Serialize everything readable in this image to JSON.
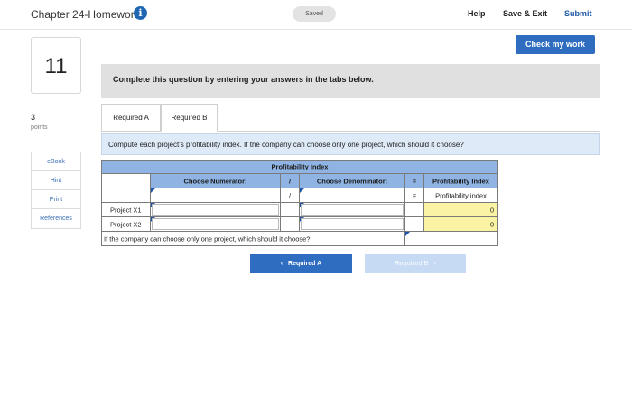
{
  "header": {
    "title": "Chapter 24-Homework",
    "info_icon_glyph": "i",
    "saved_label": "Saved",
    "help_label": "Help",
    "save_exit_label": "Save & Exit",
    "submit_label": "Submit"
  },
  "check_button_label": "Check my work",
  "question": {
    "number": "11",
    "points_value": "3",
    "points_label": "points"
  },
  "sidebar": {
    "items": [
      "eBook",
      "Hint",
      "Print",
      "References"
    ]
  },
  "banner_text": "Complete this question by entering your answers in the tabs below.",
  "tabs": [
    {
      "label": "Required A",
      "active": false
    },
    {
      "label": "Required B",
      "active": true
    }
  ],
  "instructions": "Compute each project's profitability index. If the company can choose only one project, which should it choose?",
  "table": {
    "title": "Profitability Index",
    "numerator_header": "Choose Numerator:",
    "divide_symbol": "/",
    "denominator_header": "Choose Denominator:",
    "equals_symbol": "=",
    "result_header": "Profitability Index",
    "result_subheader": "Profitability index",
    "rows": [
      {
        "label": "Project X1",
        "numerator": "",
        "denominator": "",
        "result": "0"
      },
      {
        "label": "Project X2",
        "numerator": "",
        "denominator": "",
        "result": "0"
      }
    ],
    "choice_question": "If the company can choose only one project, which should it choose?",
    "choice_answer": ""
  },
  "nav": {
    "prev_label": "Required A",
    "next_label": "Required B"
  },
  "colors": {
    "accent_blue": "#2f6dc1",
    "header_blue": "#8fb4e3",
    "result_yellow": "#fbf3a4",
    "instruction_bg": "#deeaf7"
  }
}
